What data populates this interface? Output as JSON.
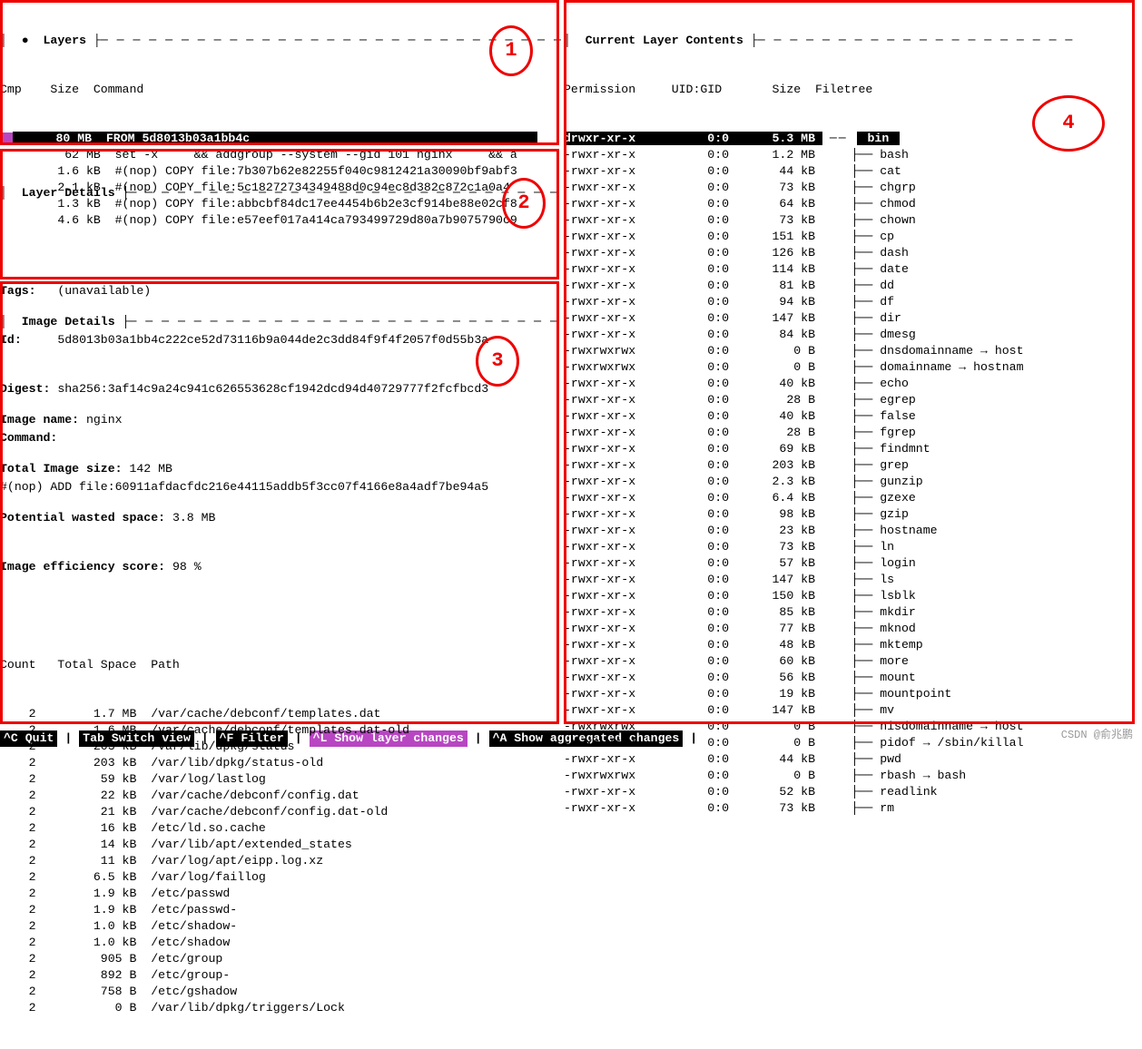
{
  "layers_panel": {
    "title": "Layers",
    "bullet": "●",
    "columns": "Cmp    Size  Command",
    "rows": [
      {
        "cmp": "pink",
        "size": "80 MB",
        "cmd": "FROM 5d8013b03a1bb4c",
        "sel": true
      },
      {
        "cmp": "",
        "size": "62 MB",
        "cmd": "set -x     && addgroup --system --gid 101 nginx     && a"
      },
      {
        "cmp": "",
        "size": "1.6 kB",
        "cmd": "#(nop) COPY file:7b307b62e82255f040c9812421a30090bf9abf3"
      },
      {
        "cmp": "",
        "size": "2.1 kB",
        "cmd": "#(nop) COPY file:5c18272734349488d0c94ec8d382c872c1a0a4"
      },
      {
        "cmp": "",
        "size": "1.3 kB",
        "cmd": "#(nop) COPY file:abbcbf84dc17ee4454b6b2e3cf914be88e02cf8"
      },
      {
        "cmp": "",
        "size": "4.6 kB",
        "cmd": "#(nop) COPY file:e57eef017a414ca793499729d80a7b9075790c9"
      }
    ]
  },
  "layer_details": {
    "title": "Layer Details",
    "tags_label": "Tags:",
    "tags_value": "(unavailable)",
    "id_label": "Id:",
    "id_value": "5d8013b03a1bb4c222ce52d73116b9a044de2c3dd84f9f4f2057f0d55b3a",
    "digest_label": "Digest:",
    "digest_value": "sha256:3af14c9a24c941c626553628cf1942dcd94d40729777f2fcfbcd3",
    "command_label": "Command:",
    "command_value": "#(nop) ADD file:60911afdacfdc216e44115addb5f3cc07f4166e8a4adf7be94a5"
  },
  "image_details": {
    "title": "Image Details",
    "image_name_label": "Image name:",
    "image_name_value": "nginx",
    "total_size_label": "Total Image size:",
    "total_size_value": "142 MB",
    "wasted_label": "Potential wasted space:",
    "wasted_value": "3.8 MB",
    "eff_label": "Image efficiency score:",
    "eff_value": "98 %",
    "columns": "Count   Total Space  Path",
    "rows": [
      {
        "count": "2",
        "space": "1.7 MB",
        "path": "/var/cache/debconf/templates.dat"
      },
      {
        "count": "2",
        "space": "1.6 MB",
        "path": "/var/cache/debconf/templates.dat-old"
      },
      {
        "count": "2",
        "space": "203 kB",
        "path": "/var/lib/dpkg/status"
      },
      {
        "count": "2",
        "space": "203 kB",
        "path": "/var/lib/dpkg/status-old"
      },
      {
        "count": "2",
        "space": "59 kB",
        "path": "/var/log/lastlog"
      },
      {
        "count": "2",
        "space": "22 kB",
        "path": "/var/cache/debconf/config.dat"
      },
      {
        "count": "2",
        "space": "21 kB",
        "path": "/var/cache/debconf/config.dat-old"
      },
      {
        "count": "2",
        "space": "16 kB",
        "path": "/etc/ld.so.cache"
      },
      {
        "count": "2",
        "space": "14 kB",
        "path": "/var/lib/apt/extended_states"
      },
      {
        "count": "2",
        "space": "11 kB",
        "path": "/var/log/apt/eipp.log.xz"
      },
      {
        "count": "2",
        "space": "6.5 kB",
        "path": "/var/log/faillog"
      },
      {
        "count": "2",
        "space": "1.9 kB",
        "path": "/etc/passwd"
      },
      {
        "count": "2",
        "space": "1.9 kB",
        "path": "/etc/passwd-"
      },
      {
        "count": "2",
        "space": "1.0 kB",
        "path": "/etc/shadow-"
      },
      {
        "count": "2",
        "space": "1.0 kB",
        "path": "/etc/shadow"
      },
      {
        "count": "2",
        "space": "905 B",
        "path": "/etc/group"
      },
      {
        "count": "2",
        "space": "892 B",
        "path": "/etc/group-"
      },
      {
        "count": "2",
        "space": "758 B",
        "path": "/etc/gshadow"
      },
      {
        "count": "2",
        "space": "0 B",
        "path": "/var/lib/dpkg/triggers/Lock"
      }
    ]
  },
  "contents": {
    "title": "Current Layer Contents",
    "columns": "Permission     UID:GID       Size  Filetree",
    "rows": [
      {
        "perm": "drwxr-xr-x",
        "ug": "0:0",
        "size": "5.3 MB",
        "tree": "",
        "name": "bin",
        "sel": true
      },
      {
        "perm": "-rwxr-xr-x",
        "ug": "0:0",
        "size": "1.2 MB",
        "tree": "├── ",
        "name": "bash"
      },
      {
        "perm": "-rwxr-xr-x",
        "ug": "0:0",
        "size": "44 kB",
        "tree": "├── ",
        "name": "cat"
      },
      {
        "perm": "-rwxr-xr-x",
        "ug": "0:0",
        "size": "73 kB",
        "tree": "├── ",
        "name": "chgrp"
      },
      {
        "perm": "-rwxr-xr-x",
        "ug": "0:0",
        "size": "64 kB",
        "tree": "├── ",
        "name": "chmod"
      },
      {
        "perm": "-rwxr-xr-x",
        "ug": "0:0",
        "size": "73 kB",
        "tree": "├── ",
        "name": "chown"
      },
      {
        "perm": "-rwxr-xr-x",
        "ug": "0:0",
        "size": "151 kB",
        "tree": "├── ",
        "name": "cp"
      },
      {
        "perm": "-rwxr-xr-x",
        "ug": "0:0",
        "size": "126 kB",
        "tree": "├── ",
        "name": "dash"
      },
      {
        "perm": "-rwxr-xr-x",
        "ug": "0:0",
        "size": "114 kB",
        "tree": "├── ",
        "name": "date"
      },
      {
        "perm": "-rwxr-xr-x",
        "ug": "0:0",
        "size": "81 kB",
        "tree": "├── ",
        "name": "dd"
      },
      {
        "perm": "-rwxr-xr-x",
        "ug": "0:0",
        "size": "94 kB",
        "tree": "├── ",
        "name": "df"
      },
      {
        "perm": "-rwxr-xr-x",
        "ug": "0:0",
        "size": "147 kB",
        "tree": "├── ",
        "name": "dir"
      },
      {
        "perm": "-rwxr-xr-x",
        "ug": "0:0",
        "size": "84 kB",
        "tree": "├── ",
        "name": "dmesg"
      },
      {
        "perm": "-rwxrwxrwx",
        "ug": "0:0",
        "size": "0 B",
        "tree": "├── ",
        "name": "dnsdomainname → host"
      },
      {
        "perm": "-rwxrwxrwx",
        "ug": "0:0",
        "size": "0 B",
        "tree": "├── ",
        "name": "domainname → hostnam"
      },
      {
        "perm": "-rwxr-xr-x",
        "ug": "0:0",
        "size": "40 kB",
        "tree": "├── ",
        "name": "echo"
      },
      {
        "perm": "-rwxr-xr-x",
        "ug": "0:0",
        "size": "28 B",
        "tree": "├── ",
        "name": "egrep"
      },
      {
        "perm": "-rwxr-xr-x",
        "ug": "0:0",
        "size": "40 kB",
        "tree": "├── ",
        "name": "false"
      },
      {
        "perm": "-rwxr-xr-x",
        "ug": "0:0",
        "size": "28 B",
        "tree": "├── ",
        "name": "fgrep"
      },
      {
        "perm": "-rwxr-xr-x",
        "ug": "0:0",
        "size": "69 kB",
        "tree": "├── ",
        "name": "findmnt"
      },
      {
        "perm": "-rwxr-xr-x",
        "ug": "0:0",
        "size": "203 kB",
        "tree": "├── ",
        "name": "grep"
      },
      {
        "perm": "-rwxr-xr-x",
        "ug": "0:0",
        "size": "2.3 kB",
        "tree": "├── ",
        "name": "gunzip"
      },
      {
        "perm": "-rwxr-xr-x",
        "ug": "0:0",
        "size": "6.4 kB",
        "tree": "├── ",
        "name": "gzexe"
      },
      {
        "perm": "-rwxr-xr-x",
        "ug": "0:0",
        "size": "98 kB",
        "tree": "├── ",
        "name": "gzip"
      },
      {
        "perm": "-rwxr-xr-x",
        "ug": "0:0",
        "size": "23 kB",
        "tree": "├── ",
        "name": "hostname"
      },
      {
        "perm": "-rwxr-xr-x",
        "ug": "0:0",
        "size": "73 kB",
        "tree": "├── ",
        "name": "ln"
      },
      {
        "perm": "-rwxr-xr-x",
        "ug": "0:0",
        "size": "57 kB",
        "tree": "├── ",
        "name": "login"
      },
      {
        "perm": "-rwxr-xr-x",
        "ug": "0:0",
        "size": "147 kB",
        "tree": "├── ",
        "name": "ls"
      },
      {
        "perm": "-rwxr-xr-x",
        "ug": "0:0",
        "size": "150 kB",
        "tree": "├── ",
        "name": "lsblk"
      },
      {
        "perm": "-rwxr-xr-x",
        "ug": "0:0",
        "size": "85 kB",
        "tree": "├── ",
        "name": "mkdir"
      },
      {
        "perm": "-rwxr-xr-x",
        "ug": "0:0",
        "size": "77 kB",
        "tree": "├── ",
        "name": "mknod"
      },
      {
        "perm": "-rwxr-xr-x",
        "ug": "0:0",
        "size": "48 kB",
        "tree": "├── ",
        "name": "mktemp"
      },
      {
        "perm": "-rwxr-xr-x",
        "ug": "0:0",
        "size": "60 kB",
        "tree": "├── ",
        "name": "more"
      },
      {
        "perm": "-rwxr-xr-x",
        "ug": "0:0",
        "size": "56 kB",
        "tree": "├── ",
        "name": "mount"
      },
      {
        "perm": "-rwxr-xr-x",
        "ug": "0:0",
        "size": "19 kB",
        "tree": "├── ",
        "name": "mountpoint"
      },
      {
        "perm": "-rwxr-xr-x",
        "ug": "0:0",
        "size": "147 kB",
        "tree": "├── ",
        "name": "mv"
      },
      {
        "perm": "-rwxrwxrwx",
        "ug": "0:0",
        "size": "0 B",
        "tree": "├── ",
        "name": "nisdomainname → host"
      },
      {
        "perm": "-rwxrwxrwx",
        "ug": "0:0",
        "size": "0 B",
        "tree": "├── ",
        "name": "pidof → /sbin/killal"
      },
      {
        "perm": "-rwxr-xr-x",
        "ug": "0:0",
        "size": "44 kB",
        "tree": "├── ",
        "name": "pwd"
      },
      {
        "perm": "-rwxrwxrwx",
        "ug": "0:0",
        "size": "0 B",
        "tree": "├── ",
        "name": "rbash → bash"
      },
      {
        "perm": "-rwxr-xr-x",
        "ug": "0:0",
        "size": "52 kB",
        "tree": "├── ",
        "name": "readlink"
      },
      {
        "perm": "-rwxr-xr-x",
        "ug": "0:0",
        "size": "73 kB",
        "tree": "├── ",
        "name": "rm"
      }
    ]
  },
  "footer": {
    "quit": "^C Quit",
    "switch": "Tab Switch view",
    "filter": "^F Filter",
    "layer_changes": "^L Show layer changes",
    "aggregated": "^A Show aggregated changes"
  },
  "watermark": "CSDN @俞兆鹏",
  "annotations": {
    "n1": "1",
    "n2": "2",
    "n3": "3",
    "n4": "4"
  }
}
